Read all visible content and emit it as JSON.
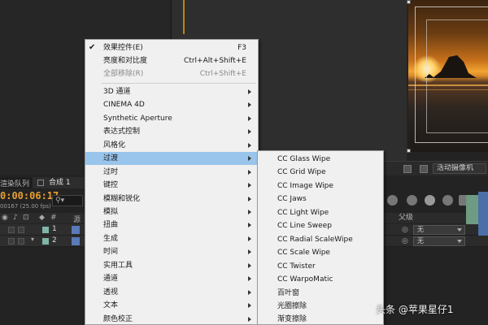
{
  "background": {
    "timeline_tab_render": "渲染队列",
    "timeline_tab_comp": "合成 1",
    "timecode": "0:00:06:17",
    "fps": "00167 (25.00 fps)",
    "search_placeholder": "⚲▾",
    "column_header_label": "源名",
    "layers": [
      {
        "number": "1"
      },
      {
        "number": "2"
      }
    ],
    "parent_header": "父级",
    "parent_values": [
      "无",
      "无"
    ],
    "viewer_camera": "活动摄像机",
    "colors": {
      "timecode": "#e8a030",
      "menu_bg": "#f0f0f0",
      "menu_highlight": "#99c4ec",
      "layer_label": "#7fb6a8"
    }
  },
  "menu": {
    "items": [
      {
        "label": "效果控件(E)",
        "shortcut": "F3",
        "checked": true
      },
      {
        "label": "亮度和对比度",
        "shortcut": "Ctrl+Alt+Shift+E"
      },
      {
        "label": "全部移除(R)",
        "shortcut": "Ctrl+Shift+E",
        "disabled": true
      },
      {
        "label": "3D 通道",
        "submenu": true
      },
      {
        "label": "CINEMA 4D",
        "submenu": true
      },
      {
        "label": "Synthetic Aperture",
        "submenu": true
      },
      {
        "label": "表达式控制",
        "submenu": true
      },
      {
        "label": "风格化",
        "submenu": true
      },
      {
        "label": "过渡",
        "submenu": true,
        "highlighted": true
      },
      {
        "label": "过时",
        "submenu": true
      },
      {
        "label": "键控",
        "submenu": true
      },
      {
        "label": "模糊和锐化",
        "submenu": true
      },
      {
        "label": "模拟",
        "submenu": true
      },
      {
        "label": "扭曲",
        "submenu": true
      },
      {
        "label": "生成",
        "submenu": true
      },
      {
        "label": "时间",
        "submenu": true
      },
      {
        "label": "实用工具",
        "submenu": true
      },
      {
        "label": "通道",
        "submenu": true
      },
      {
        "label": "透视",
        "submenu": true
      },
      {
        "label": "文本",
        "submenu": true
      },
      {
        "label": "颜色校正",
        "submenu": true
      }
    ]
  },
  "submenu": {
    "items": [
      "CC Glass Wipe",
      "CC Grid Wipe",
      "CC Image Wipe",
      "CC Jaws",
      "CC Light Wipe",
      "CC Line Sweep",
      "CC Radial ScaleWipe",
      "CC Scale Wipe",
      "CC Twister",
      "CC WarpoMatic",
      "百叶窗",
      "光圈擦除",
      "渐变擦除"
    ]
  },
  "watermark": "头条 @苹果星仔1"
}
